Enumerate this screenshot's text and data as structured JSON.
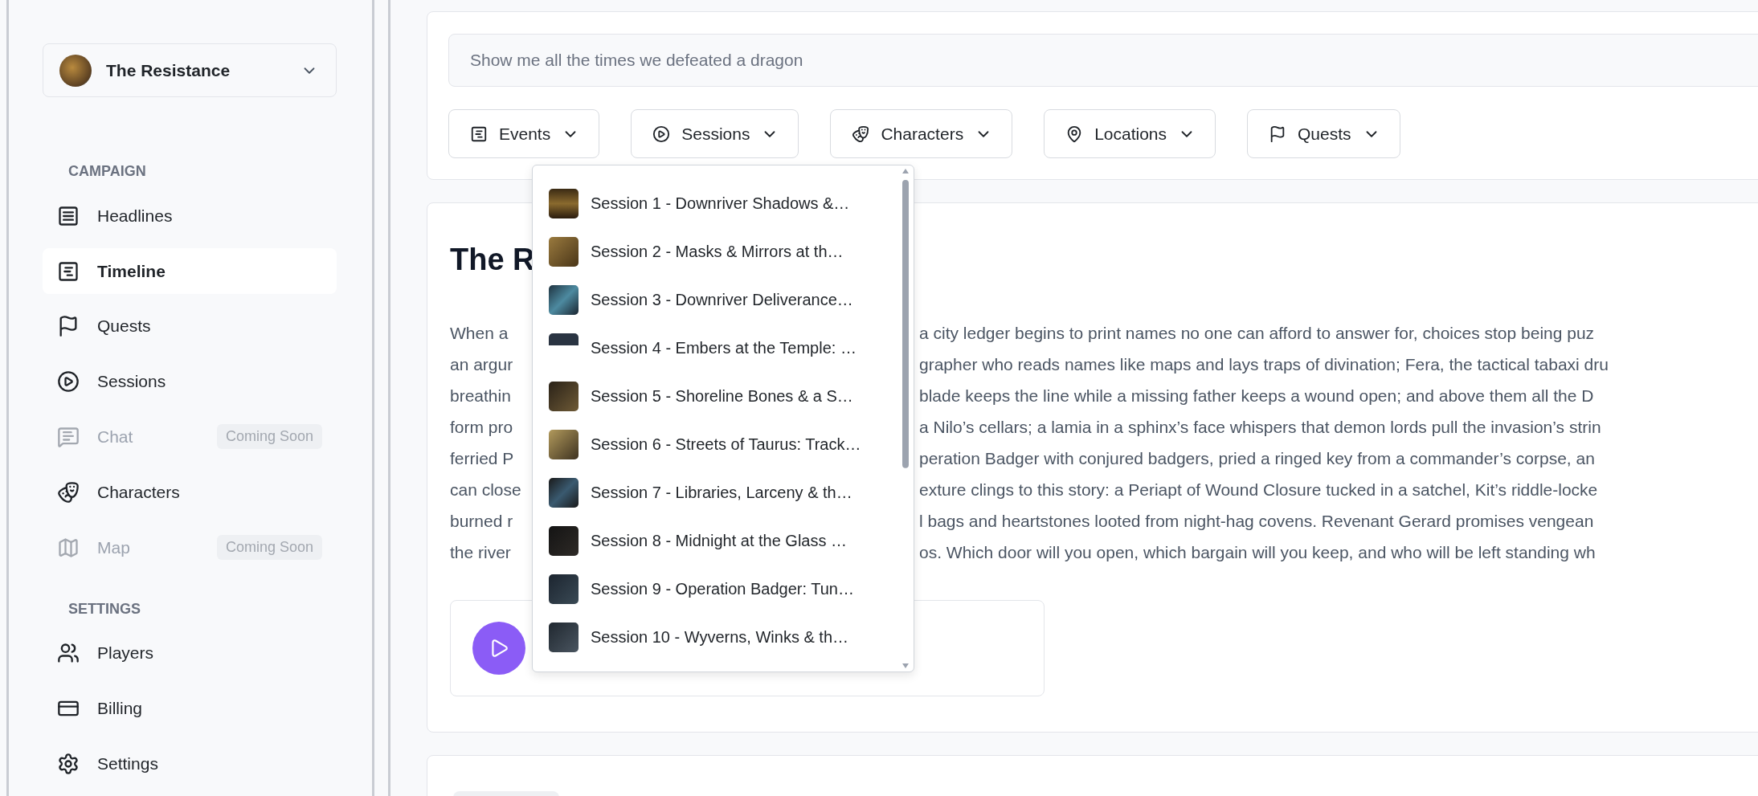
{
  "campaign_selector": {
    "name": "The Resistance"
  },
  "sidebar": {
    "sections": [
      {
        "heading": "CAMPAIGN",
        "items": [
          {
            "label": "Headlines",
            "selected": false,
            "disabled": false
          },
          {
            "label": "Timeline",
            "selected": true,
            "disabled": false
          },
          {
            "label": "Quests",
            "selected": false,
            "disabled": false
          },
          {
            "label": "Sessions",
            "selected": false,
            "disabled": false
          },
          {
            "label": "Chat",
            "selected": false,
            "disabled": true,
            "badge": "Coming Soon"
          },
          {
            "label": "Characters",
            "selected": false,
            "disabled": false
          },
          {
            "label": "Map",
            "selected": false,
            "disabled": true,
            "badge": "Coming Soon"
          }
        ]
      },
      {
        "heading": "SETTINGS",
        "items": [
          {
            "label": "Players",
            "selected": false,
            "disabled": false
          },
          {
            "label": "Billing",
            "selected": false,
            "disabled": false
          },
          {
            "label": "Settings",
            "selected": false,
            "disabled": false
          }
        ]
      }
    ]
  },
  "search": {
    "placeholder": "Show me all the times we defeated a dragon"
  },
  "filters": [
    {
      "label": "Events"
    },
    {
      "label": "Sessions"
    },
    {
      "label": "Characters"
    },
    {
      "label": "Locations"
    },
    {
      "label": "Quests"
    }
  ],
  "session_menu": {
    "items": [
      "Session 1 - Downriver Shadows &…",
      "Session 2 - Masks & Mirrors at th…",
      "Session 3 - Downriver Deliverance…",
      "Session 4 - Embers at the Temple: …",
      "Session 5 - Shoreline Bones & a S…",
      "Session 6 - Streets of Taurus: Track…",
      "Session 7 - Libraries, Larceny & th…",
      "Session 8 - Midnight at the Glass …",
      "Session 9 - Operation Badger: Tun…",
      "Session 10 - Wyverns, Winks & th…"
    ]
  },
  "story": {
    "title": "The R",
    "lines": [
      {
        "left": "When a",
        "right": "a city ledger begins to print names no one can afford to answer for, choices stop being puz"
      },
      {
        "left": "an argur",
        "right": "grapher who reads names like maps and lays traps of divination; Fera, the tactical tabaxi dru"
      },
      {
        "left": "breathin",
        "right": "blade keeps the line while a missing father keeps a wound open; and above them all the D"
      },
      {
        "left": "form pro",
        "right": "a Nilo’s cellars; a lamia in a sphinx’s face whispers that demon lords pull the invasion’s strin"
      },
      {
        "left": "ferried P",
        "right": "peration Badger with conjured badgers, pried a ringed key from a commander’s corpse, an"
      },
      {
        "left": "can close",
        "right": "exture clings to this story: a Periapt of Wound Closure tucked in a satchel, Kit’s riddle-locke"
      },
      {
        "left": "burned r",
        "right": "l bags and heartstones looted from night-hag covens. Revenant Gerard promises vengean"
      },
      {
        "left": "the river",
        "right": "os. Which door will you open, which bargain will you keep, and who will be left standing wh"
      }
    ]
  }
}
